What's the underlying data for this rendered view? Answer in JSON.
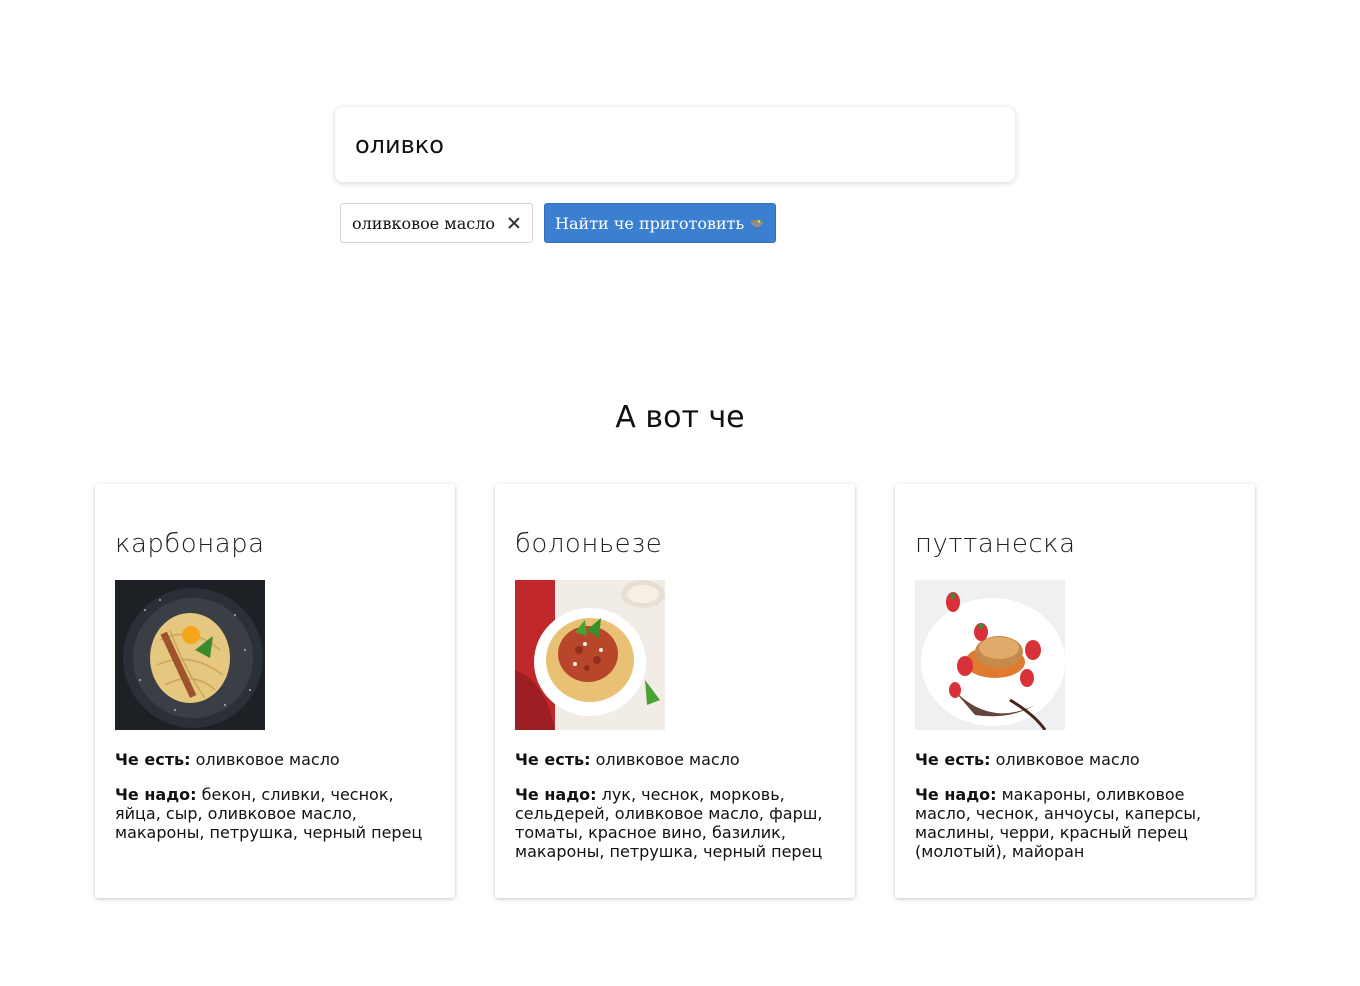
{
  "search": {
    "value": "оливко",
    "placeholder": ""
  },
  "chips": [
    {
      "label": "оливковое масло"
    }
  ],
  "find_button": {
    "label": "Найти че приготовить",
    "icon": "bowl-icon"
  },
  "section": {
    "title": "А вот че"
  },
  "labels": {
    "have": "Че есть:",
    "need": "Че надо:"
  },
  "recipes": [
    {
      "title": "карбонара",
      "image_icon": "carbonara-image",
      "have": "оливковое масло",
      "need": "бекон, сливки, чеснок, яйца, сыр, оливковое масло, макароны, петрушка, черный перец"
    },
    {
      "title": "болоньезе",
      "image_icon": "bolognese-image",
      "have": "оливковое масло",
      "need": "лук, чеснок, морковь, сельдерей, оливковое масло, фарш, томаты, красное вино, базилик, макароны, петрушка, черный перец"
    },
    {
      "title": "путтанеска",
      "image_icon": "puttanesca-image",
      "have": "оливковое масло",
      "need": "макароны, оливковое масло, чеснок, анчоусы, каперсы, маслины, черри, красный перец (молотый), майоран"
    }
  ],
  "colors": {
    "button_bg": "#3b7fd0",
    "card_bg": "#ffffff"
  }
}
